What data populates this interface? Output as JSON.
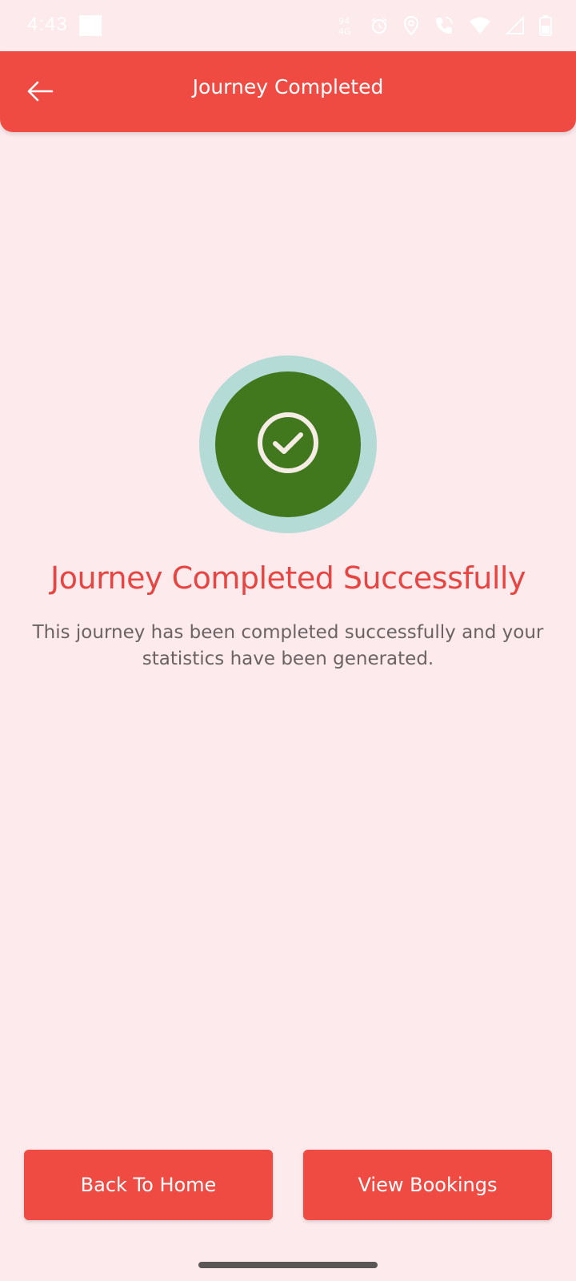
{
  "status_bar": {
    "time": "4:43",
    "icons": [
      "data-saver-icon",
      "alarm-icon",
      "location-icon",
      "wifi-calling-icon",
      "wifi-icon",
      "signal-icon",
      "battery-icon"
    ]
  },
  "app_bar": {
    "title": "Journey Completed",
    "back_icon": "arrow-left-icon"
  },
  "success": {
    "icon": "check-circle-icon",
    "title": "Journey Completed Successfully",
    "message": "This journey has been completed successfully and your statistics have been generated."
  },
  "actions": {
    "back_to_home": "Back To Home",
    "view_bookings": "View Bookings"
  },
  "colors": {
    "background": "#fdeaec",
    "accent": "#ef4b43",
    "success_green": "#41771d",
    "success_ring": "#b5dbd7",
    "title_red": "#e64541"
  }
}
